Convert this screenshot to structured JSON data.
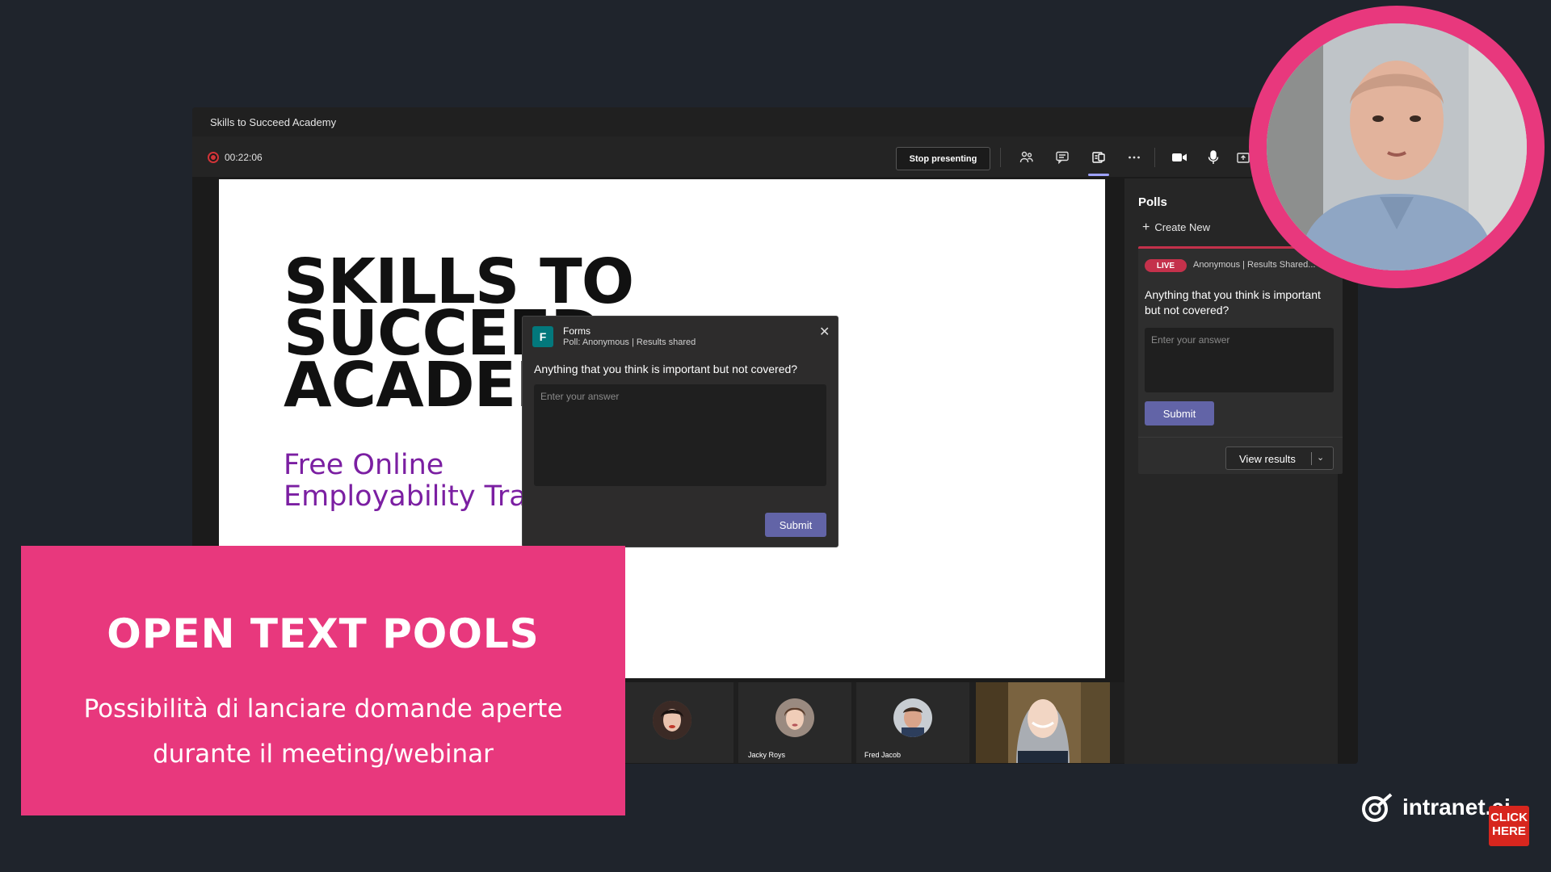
{
  "window": {
    "title": "Skills to Succeed Academy"
  },
  "toolbar": {
    "timer": "00:22:06",
    "stop_presenting": "Stop presenting",
    "icons": [
      "recording-icon",
      "participants-icon",
      "chat-icon",
      "apps-icon",
      "more-icon",
      "camera-icon",
      "mic-icon",
      "share-icon"
    ]
  },
  "slide": {
    "title_lines": [
      "SKILLS TO",
      "SUCCEED",
      "ACADEMY"
    ],
    "subtitle_lines": [
      "Free Online",
      "Employability Training"
    ],
    "subtitle_color": "#7b1fa2"
  },
  "forms_dialog": {
    "app_name": "Forms",
    "meta": "Poll: Anonymous | Results shared",
    "question": "Anything that you think is important but not covered?",
    "placeholder": "Enter your answer",
    "submit_label": "Submit"
  },
  "polls_panel": {
    "title": "Polls",
    "create_new": "Create New",
    "live_badge": "LIVE",
    "poll_meta": "Anonymous | Results Shared...",
    "question": "Anything that you think is important but not covered?",
    "placeholder": "Enter your answer",
    "submit_label": "Submit",
    "view_results": "View results"
  },
  "participants": [
    {
      "name": ""
    },
    {
      "name": "Jacky Roys"
    },
    {
      "name": "Fred Jacob"
    },
    {
      "name": ""
    }
  ],
  "overlay": {
    "title": "OPEN TEXT POOLS",
    "description_lines": [
      "Possibilità di lanciare domande aperte",
      "durante il meeting/webinar"
    ]
  },
  "brand": {
    "name": "intranet.ai",
    "cta_line1": "CLICK",
    "cta_line2": "HERE"
  },
  "colors": {
    "background": "#1f242c",
    "accent_pink": "#e8387d",
    "teams_purple": "#6264a7",
    "live_red": "#c4314b"
  }
}
